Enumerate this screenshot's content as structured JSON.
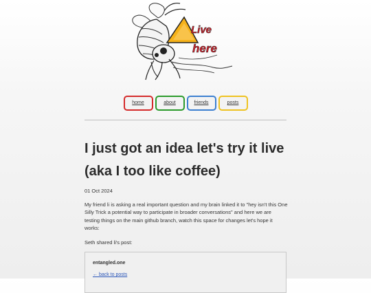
{
  "logo": {
    "line1": "Live",
    "line2": "here"
  },
  "nav": [
    {
      "label": "home"
    },
    {
      "label": "about"
    },
    {
      "label": "friends"
    },
    {
      "label": "posts"
    }
  ],
  "post": {
    "title_line1": "I just got an idea let's try it live",
    "title_line2": "(aka I too like coffee)",
    "date": "01 Oct 2024",
    "paragraph1": "My friend li is asking a real important question and my brain linked it to \"hey isn't this One Silly Trick a potential way to participate in broader conversations\" and here we are testing things on the main github branch, watch this space for changes let's hope it works:",
    "paragraph2": "Seth shared li's post:"
  },
  "embed": {
    "site": "entangled.one",
    "back_link": "← back to posts"
  },
  "colors": {
    "home_border": "#d42a2a",
    "about_border": "#2a9a2a",
    "friends_border": "#3b7fd0",
    "posts_border": "#eec21f",
    "logo_triangle": "#f6b21a"
  }
}
